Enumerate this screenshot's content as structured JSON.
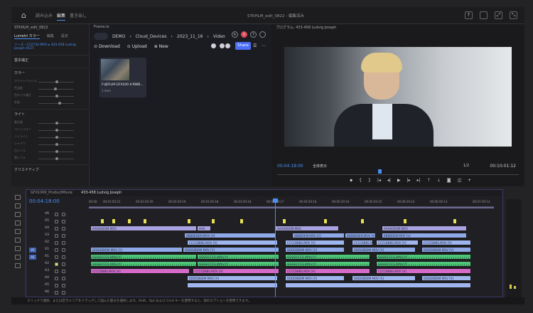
{
  "topbar": {
    "tabs": [
      "読み込み",
      "編集",
      "書き出し"
    ],
    "active_tab": "編集",
    "app_title": "STKHLM_edit_0822 - 編集済み"
  },
  "left_panel": {
    "header_title": "STKHLM_edit_0822",
    "tabs": [
      "Lumetri カラー",
      "編集",
      "設定"
    ],
    "source_label": "ソース・512732.MXV  ▸  433-458 Ludvig Joseph 0127",
    "sections": [
      "基本補正",
      "カラー",
      "ライト",
      "クリエイティブ"
    ],
    "color_sliders": [
      "ホワイトバランス",
      "色温度",
      "色かぶり補正",
      "彩度"
    ],
    "light_sliders": [
      "露光量",
      "コントラスト",
      "ハイライト",
      "シャドウ",
      "白レベル",
      "黒レベル"
    ]
  },
  "frameio": {
    "panel_title": "Frame.io",
    "breadcrumbs": [
      "DEMO",
      "Cloud_Devices",
      "2023_11_16",
      "Video"
    ],
    "notification_count": "5",
    "actions": [
      "Download",
      "Upload",
      "New"
    ],
    "share_label": "Share",
    "asset": {
      "name": "FUJIFILM GFX100 II-RWB...",
      "count": "1 item"
    }
  },
  "program": {
    "title": "プログラム: 433-458 Ludvig Joseph",
    "timecode": "00:04:18:00",
    "fit": "全体表示",
    "resolution": "1/2",
    "duration": "00:10:01:12"
  },
  "timeline": {
    "tabs": [
      "GFX100II_ProductMovie",
      "433-458 Ludvig Joseph"
    ],
    "active_tab": "433-458 Ludvig Joseph",
    "timecode": "00:04:18:00",
    "ruler": [
      "00:00",
      "00:01:59:21",
      "00:02:29:20",
      "00:02:59:19",
      "00:03:29:18",
      "00:03:59:18",
      "00:04:29:17",
      "00:04:59:16",
      "00:05:29:16",
      "00:05:59:15",
      "00:06:29:14",
      "00:06:59:13",
      "00:07:29:13"
    ],
    "video_tracks": [
      "V6",
      "V5",
      "V4",
      "V3",
      "V2",
      "V1"
    ],
    "audio_tracks": [
      "A1",
      "A2",
      "A3",
      "A4",
      "A5",
      "A6"
    ],
    "clip_labels": {
      "v3": [
        "AAAAOEOM.MOV",
        "AAA",
        "AAAAOEOM.MOV",
        "AAAAOEOM.MOV"
      ],
      "v2": [
        "BBBBBDEM.MOV [V]",
        "BBBBOEM.MOV [V]",
        "BBBBBDEM.MOV [V]",
        "BBBBOEM.MOV [V]"
      ],
      "v1b": [
        "CCCCBBBS.MOV [V]",
        "CCCCBBBS.MOV [V]",
        "CCCCBBBS.MOV [V]",
        "CCCCBBBS.MOV [V]",
        "CCCCBBBS.MOV [V]"
      ],
      "v1": [
        "DDDDBBDM.MOV [V]",
        "DDDDBBDM.MOV [V]",
        "DDDDBBDM.MOV [V]",
        "DDDDBBDM.MOV [V]",
        "DDDDBBDM.MOV [V]"
      ],
      "a1": [
        "GGGGCCCG.WAV [A]",
        "GGGGCCCG.WAV [A]",
        "GGGGCCCG.WAV [A]",
        "GGGGCCCG.WAV [A]"
      ],
      "a2": [
        "GGGGCCCG.WAV [A]",
        "GGGGCCCG.WAV [A]",
        "GGGGCCCG.WAV [A]",
        "GGGGCCCG.WAV [A]"
      ],
      "a3": [
        "CCCCBBBS.MOV [A]",
        "CCCCBBBS.MOV [A]",
        "CCCCBBBS.MOV [A]",
        "CCCCBBBS.MOV [A]"
      ],
      "a4": [
        "DDDDBBDM.MOV [A]",
        "DDDDBBDM.MOV [A]",
        "DDDDBBDM.MOV [A]",
        "DDDDBBDM.MOV [A]"
      ]
    }
  },
  "status": "クリックで選択、または空きエリアをドラッグして囲んだ部分を選択します。Shift、Opt および Cmd キーを使用すると、他のオプションを使用できます。"
}
